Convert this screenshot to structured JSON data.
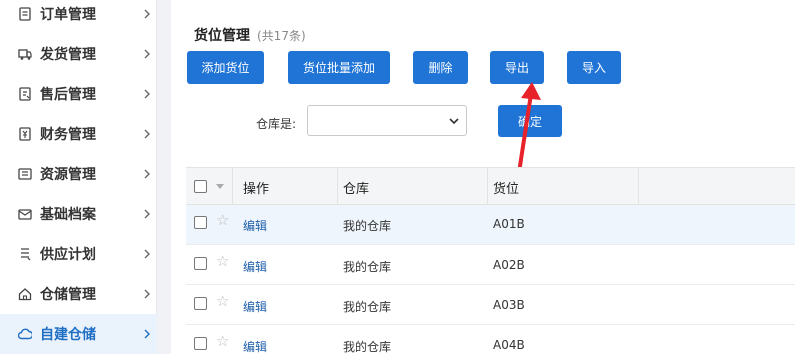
{
  "sidebar": {
    "items": [
      {
        "label": "订单管理",
        "icon": "order-icon"
      },
      {
        "label": "发货管理",
        "icon": "truck-icon"
      },
      {
        "label": "售后管理",
        "icon": "aftersale-icon"
      },
      {
        "label": "财务管理",
        "icon": "finance-icon"
      },
      {
        "label": "资源管理",
        "icon": "resource-icon"
      },
      {
        "label": "基础档案",
        "icon": "mail-icon"
      },
      {
        "label": "供应计划",
        "icon": "plan-icon"
      },
      {
        "label": "仓储管理",
        "icon": "home-icon"
      },
      {
        "label": "自建仓储",
        "icon": "cloud-icon",
        "active": true
      }
    ]
  },
  "main": {
    "title": "货位管理",
    "count": "(共17条)",
    "buttons": {
      "add": "添加货位",
      "batch_add": "货位批量添加",
      "delete": "删除",
      "export": "导出",
      "import": "导入"
    },
    "filter": {
      "label": "仓库是:",
      "value": "",
      "confirm": "确定"
    },
    "table": {
      "columns": [
        "操作",
        "仓库",
        "货位"
      ],
      "rows": [
        {
          "action": "编辑",
          "warehouse": "我的仓库",
          "location": "A01B"
        },
        {
          "action": "编辑",
          "warehouse": "我的仓库",
          "location": "A02B"
        },
        {
          "action": "编辑",
          "warehouse": "我的仓库",
          "location": "A03B"
        },
        {
          "action": "编辑",
          "warehouse": "我的仓库",
          "location": "A04B"
        }
      ]
    }
  },
  "colors": {
    "accent": "#1f74d6",
    "arrow": "#e8222a",
    "active_bg": "#eaf2fb"
  }
}
